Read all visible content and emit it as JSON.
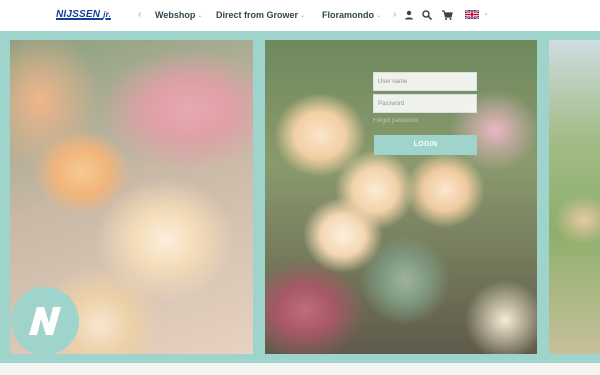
{
  "header": {
    "logo_text": "NIJSSEN",
    "logo_suffix": "jr.",
    "prev_arrow": "‹",
    "next_arrow": "›",
    "nav_items": [
      {
        "label": "Webshop",
        "chevron": "⌄"
      },
      {
        "label": "Direct from Grower",
        "chevron": "⌄"
      },
      {
        "label": "Floramondo",
        "chevron": "⌄"
      }
    ],
    "icons": [
      "user-icon",
      "search-icon",
      "cart-icon",
      "uk-flag-icon",
      "chevron-down-icon"
    ],
    "language_chevron": "⌄"
  },
  "login": {
    "username_placeholder": "User name",
    "password_placeholder": "Password",
    "hint_text": "Forgot password",
    "submit_label": "LOGIN"
  },
  "badge": {
    "letter": "N"
  },
  "colors": {
    "accent": "#9ed4cc",
    "logo": "#123f9c",
    "nav_text": "#33464f"
  }
}
